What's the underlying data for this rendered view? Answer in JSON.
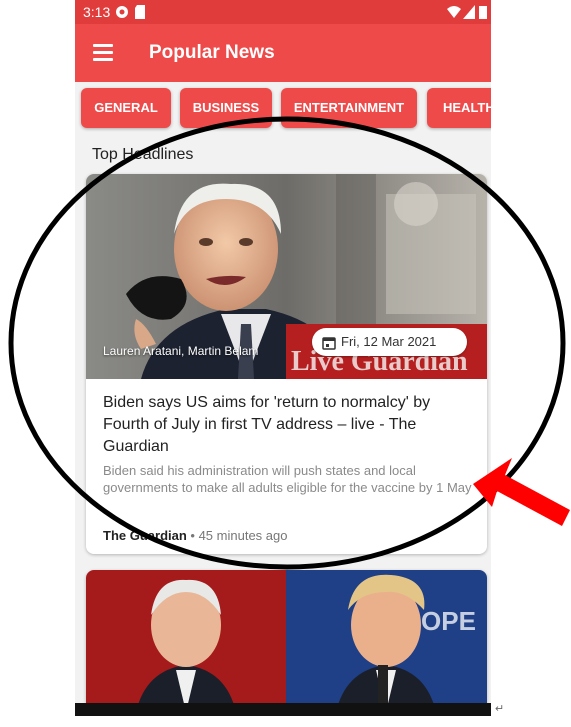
{
  "status_bar": {
    "time": "3:13"
  },
  "app_bar": {
    "title": "Popular News"
  },
  "categories": [
    "GENERAL",
    "BUSINESS",
    "ENTERTAINMENT",
    "HEALTH"
  ],
  "section_title": "Top Headlines",
  "article": {
    "author": "Lauren Aratani, Martin Belam",
    "date": "Fri, 12 Mar 2021",
    "headline": "Biden says US aims for 'return to normalcy' by Fourth of July in first TV address – live - The Guardian",
    "description": "Biden said his administration will push states and local governments to make all adults eligible for the vaccine by 1 May",
    "source": "The Guardian",
    "separator": " • ",
    "time_ago": "45 minutes ago",
    "image_overlay_text": "Live Guardian"
  },
  "colors": {
    "primary": "#ef4a4a",
    "status": "#e03c3c",
    "annotation": "#ff0000"
  },
  "corner_mark": "↵"
}
